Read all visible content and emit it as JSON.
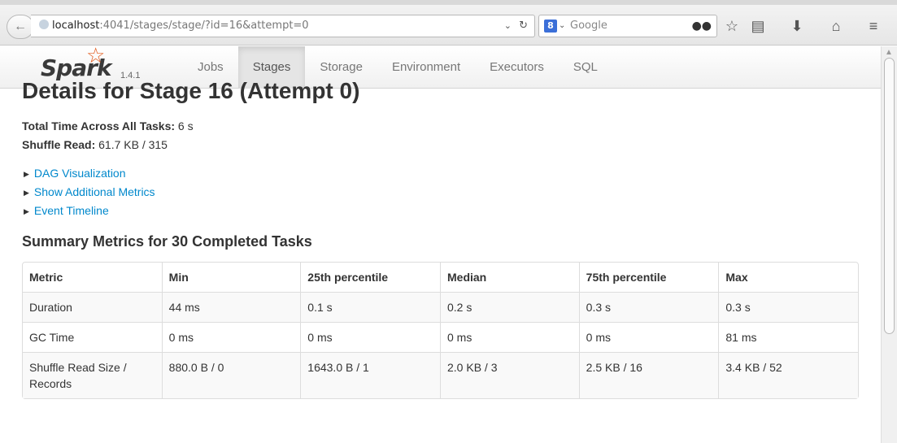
{
  "browser": {
    "url_host": "localhost",
    "url_rest": ":4041/stages/stage/?id=16&attempt=0",
    "search_placeholder": "Google",
    "icons": [
      "back-arrow-icon",
      "globe-icon",
      "dropdown-caret-icon",
      "reload-icon",
      "google-icon",
      "binoculars-icon",
      "star-icon",
      "reading-list-icon",
      "download-icon",
      "home-icon",
      "menu-icon"
    ]
  },
  "nav": {
    "brand": "Spark",
    "version": "1.4.1",
    "tabs": [
      {
        "label": "Jobs",
        "active": false
      },
      {
        "label": "Stages",
        "active": true
      },
      {
        "label": "Storage",
        "active": false
      },
      {
        "label": "Environment",
        "active": false
      },
      {
        "label": "Executors",
        "active": false
      },
      {
        "label": "SQL",
        "active": false
      }
    ]
  },
  "page": {
    "title": "Details for Stage 16 (Attempt 0)",
    "total_time_label": "Total Time Across All Tasks:",
    "total_time_value": " 6 s",
    "shuffle_read_label": "Shuffle Read:",
    "shuffle_read_value": " 61.7 KB / 315",
    "expanders": [
      "DAG Visualization",
      "Show Additional Metrics",
      "Event Timeline"
    ],
    "summary_title": "Summary Metrics for 30 Completed Tasks"
  },
  "table": {
    "headers": [
      "Metric",
      "Min",
      "25th percentile",
      "Median",
      "75th percentile",
      "Max"
    ],
    "rows": [
      [
        "Duration",
        "44 ms",
        "0.1 s",
        "0.2 s",
        "0.3 s",
        "0.3 s"
      ],
      [
        "GC Time",
        "0 ms",
        "0 ms",
        "0 ms",
        "0 ms",
        "81 ms"
      ],
      [
        "Shuffle Read Size / Records",
        "880.0 B / 0",
        "1643.0 B / 1",
        "2.0 KB / 3",
        "2.5 KB / 16",
        "3.4 KB / 52"
      ]
    ]
  },
  "colors": {
    "link": "#0088cc",
    "brand_star": "#e25a1c",
    "active_tab_bg": "#e5e5e5"
  }
}
